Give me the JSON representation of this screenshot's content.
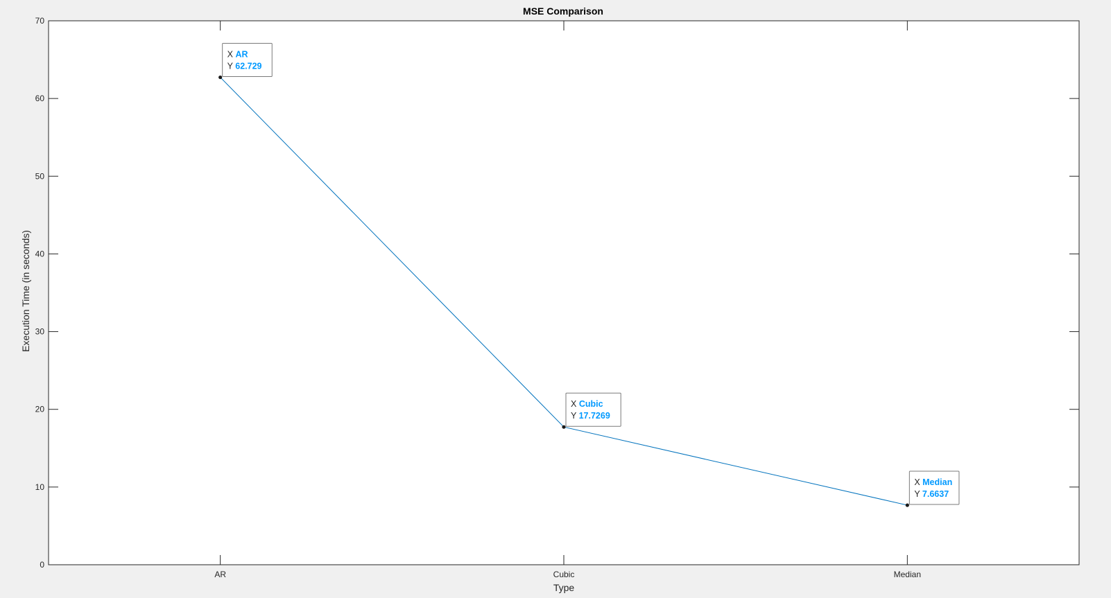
{
  "chart_data": {
    "type": "line",
    "title": "MSE Comparison",
    "xlabel": "Type",
    "ylabel": "Execution Time (in seconds)",
    "categories": [
      "AR",
      "Cubic",
      "Median"
    ],
    "values": [
      62.729,
      17.7269,
      7.6637
    ],
    "value_labels": [
      "62.729",
      "17.7269",
      "7.6637"
    ],
    "ylim": [
      0,
      70
    ],
    "yticks": [
      0,
      10,
      20,
      30,
      40,
      50,
      60,
      70
    ],
    "grid": false,
    "legend": "none",
    "datatip_prefix_x": "X",
    "datatip_prefix_y": "Y",
    "colors": {
      "line": "#0072bd",
      "datatip_value": "#0099ff",
      "figure_bg": "#f0f0f0",
      "axes_bg": "#ffffff",
      "axis": "#262626"
    }
  }
}
